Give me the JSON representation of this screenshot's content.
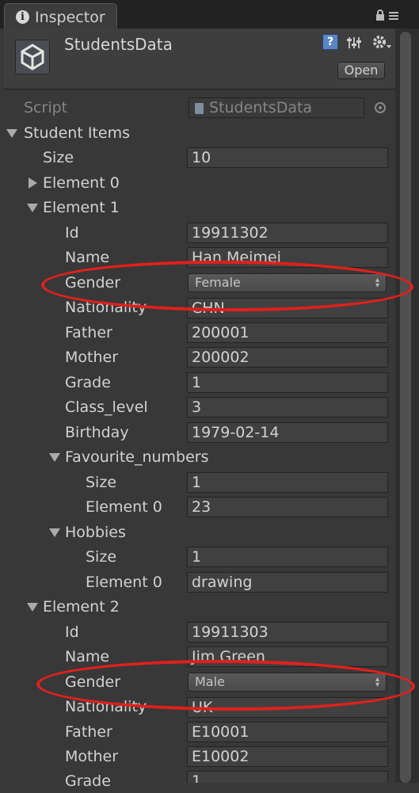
{
  "tab": {
    "title": "Inspector"
  },
  "header": {
    "asset_name": "StudentsData",
    "open_label": "Open"
  },
  "script": {
    "label": "Script",
    "value": "StudentsData"
  },
  "root": {
    "label": "Student Items"
  },
  "size": {
    "label": "Size",
    "value": "10"
  },
  "element0": {
    "label": "Element 0"
  },
  "element1": {
    "label": "Element 1",
    "id": {
      "label": "Id",
      "value": "19911302"
    },
    "name": {
      "label": "Name",
      "value": "Han Meimei"
    },
    "gender": {
      "label": "Gender",
      "value": "Female"
    },
    "nationality": {
      "label": "Nationality",
      "value": "CHN"
    },
    "father": {
      "label": "Father",
      "value": "200001"
    },
    "mother": {
      "label": "Mother",
      "value": "200002"
    },
    "grade": {
      "label": "Grade",
      "value": "1"
    },
    "class_level": {
      "label": "Class_level",
      "value": "3"
    },
    "birthday": {
      "label": "Birthday",
      "value": "1979-02-14"
    },
    "favourite_numbers": {
      "label": "Favourite_numbers",
      "size_label": "Size",
      "size": "1",
      "e0_label": "Element 0",
      "e0": "23"
    },
    "hobbies": {
      "label": "Hobbies",
      "size_label": "Size",
      "size": "1",
      "e0_label": "Element 0",
      "e0": "drawing"
    }
  },
  "element2": {
    "label": "Element 2",
    "id": {
      "label": "Id",
      "value": "19911303"
    },
    "name": {
      "label": "Name",
      "value": "Jim Green"
    },
    "gender": {
      "label": "Gender",
      "value": "Male"
    },
    "nationality": {
      "label": "Nationality",
      "value": "UK"
    },
    "father": {
      "label": "Father",
      "value": "E10001"
    },
    "mother": {
      "label": "Mother",
      "value": "E10002"
    },
    "grade": {
      "label": "Grade",
      "value": "1"
    }
  },
  "colors": {
    "highlight": "#e0201c",
    "background": "#383838"
  }
}
